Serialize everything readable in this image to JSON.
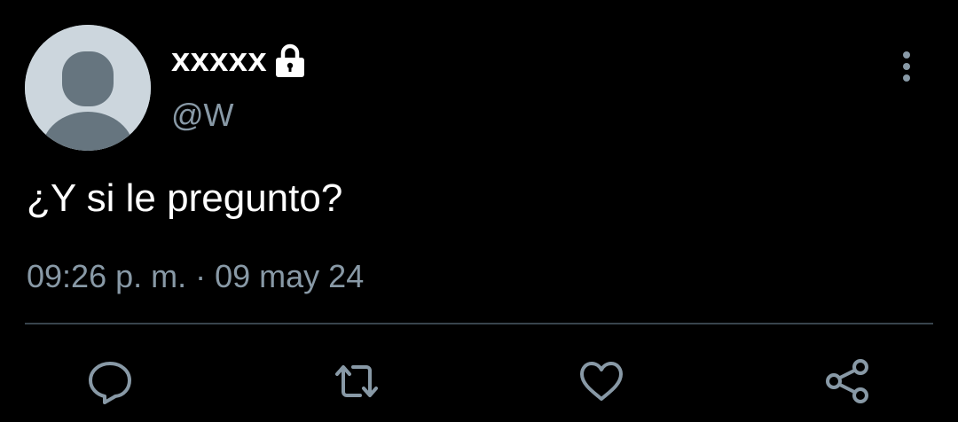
{
  "user": {
    "display_name": "xxxxx",
    "handle": "@W",
    "protected_icon": "lock-icon",
    "avatar": "default-avatar"
  },
  "tweet": {
    "text": "¿Y si le pregunto?",
    "time": "09:26 p. m.",
    "separator": " · ",
    "date": "09 may 24"
  },
  "actions": [
    {
      "icon": "reply-icon"
    },
    {
      "icon": "retweet-icon"
    },
    {
      "icon": "heart-icon"
    },
    {
      "icon": "share-icon"
    }
  ],
  "menu_icon": "more-vertical-icon",
  "colors": {
    "background": "#000000",
    "primary_text": "#ffffff",
    "secondary_text": "#8899a6",
    "divider": "#38444d",
    "avatar_bg": "#ccd6dd",
    "avatar_fg": "#66757f"
  }
}
